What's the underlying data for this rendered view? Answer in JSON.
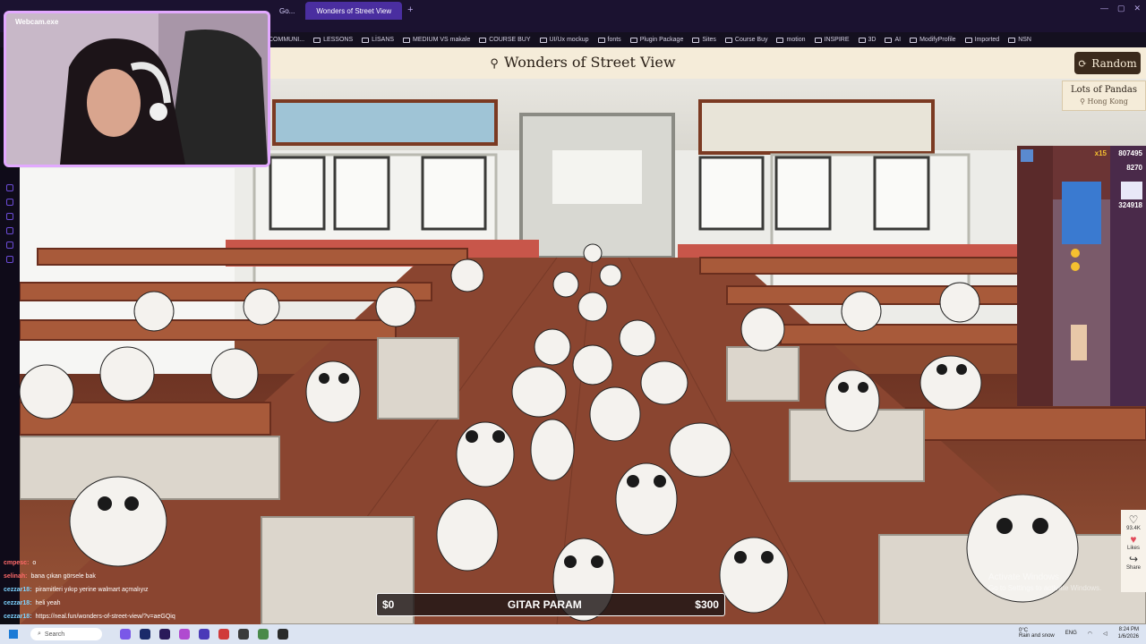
{
  "browser": {
    "tabs": [
      {
        "label": "Go..."
      },
      {
        "label": "Wonders of Street View",
        "active": true
      }
    ],
    "bookmarks": [
      "COMMUNI...",
      "LESSONS",
      "LİSANS",
      "MEDIUM VS makale",
      "COURSE BUY",
      "UI/Ux mockup",
      "fonts",
      "Plugin Package",
      "Sites",
      "Course Buy",
      "motion",
      "INSPIRE",
      "3D",
      "AI",
      "ModifyProfile",
      "Imported",
      "NSN"
    ]
  },
  "site": {
    "title": "Wonders of Street View",
    "random_label": "Random",
    "location_name": "Lots of Pandas",
    "location_region": "Hong Kong"
  },
  "webcam": {
    "label": "Webcam.exe"
  },
  "game": {
    "score1": "807495",
    "score2": "8270",
    "score3": "324918",
    "multiplier": "x15"
  },
  "chat": [
    {
      "user": "cmpesc:",
      "text": "o",
      "color": "#ff6a6a"
    },
    {
      "user": "selinah:",
      "text": "bana çıkan görsele bak",
      "color": "#ff6a6a"
    },
    {
      "user": "cezzar18:",
      "text": "piramitleri yıkıp yerine walmart açmalıyız",
      "color": "#7dd3ff"
    },
    {
      "user": "cezzar18:",
      "text": "heli yeah",
      "color": "#7dd3ff"
    },
    {
      "user": "cezzar18:",
      "text": "https://neal.fun/wonders-of-street-view/?v=aeGQiq",
      "color": "#7dd3ff"
    }
  ],
  "donation": {
    "left": "$0",
    "title": "GITAR PARAM",
    "right": "$300",
    "progress": 0.0
  },
  "social": {
    "likes_count": "93.4K",
    "likes_label": "Likes",
    "share_label": "Share"
  },
  "watermark": {
    "title": "Activate Windows",
    "subtitle": "Go to Settings to activate Windows."
  },
  "taskbar": {
    "search_placeholder": "Search",
    "weather": "0°C",
    "weather_sub": "Rain and snow",
    "lang": "ENG",
    "time": "8:24 PM",
    "date": "1/6/2026"
  },
  "colors": {
    "accent": "#4a2ea0",
    "header_bg": "#f5ecd9",
    "brown": "#3b2a1c"
  }
}
